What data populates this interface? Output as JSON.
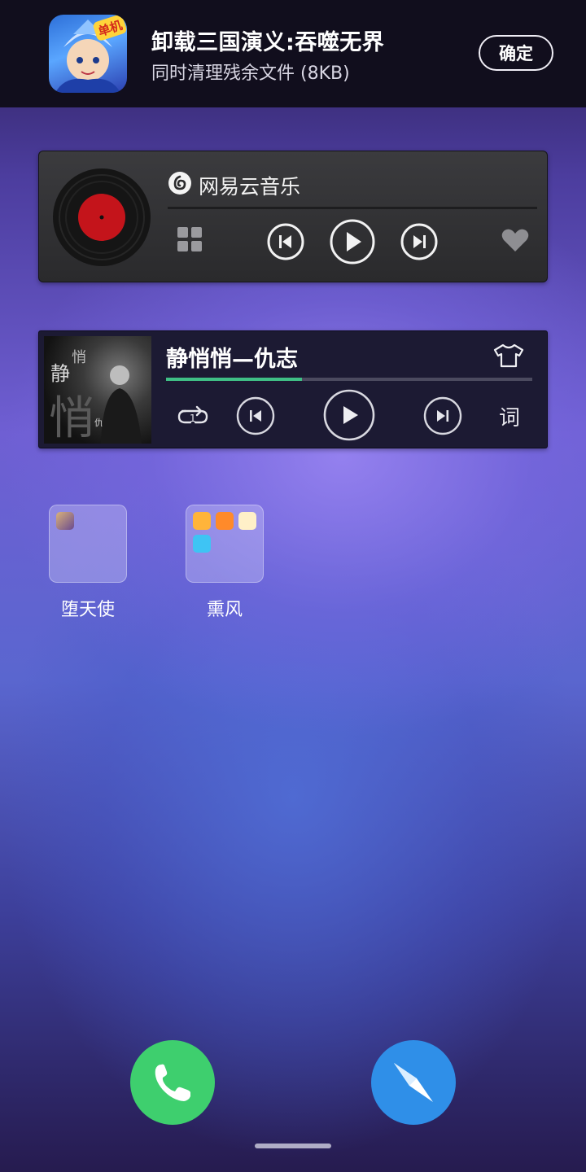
{
  "notification": {
    "title": "卸载三国演义:吞噬无界",
    "subtitle": "同时清理残余文件 (8KB)",
    "confirm_label": "确定",
    "badge_text": "单机"
  },
  "widget_netease": {
    "brand": "网易云音乐",
    "icons": [
      "vinyl-record-icon",
      "netease-logo-icon",
      "grid-icon",
      "previous-icon",
      "play-icon",
      "next-icon",
      "heart-icon"
    ]
  },
  "widget_player": {
    "song_title": "静悄悄—仇志",
    "progress": 0.37,
    "lyric_button": "词",
    "cover_text": {
      "a": "静",
      "b": "悄",
      "c": "悄",
      "d": "仇志"
    },
    "accent_color": "#3fbf86"
  },
  "folders": [
    {
      "label": "堕天使"
    },
    {
      "label": "熏风"
    }
  ],
  "dock": {
    "phone_color": "#3ecf6e",
    "browser_color": "#2f8fe8"
  }
}
